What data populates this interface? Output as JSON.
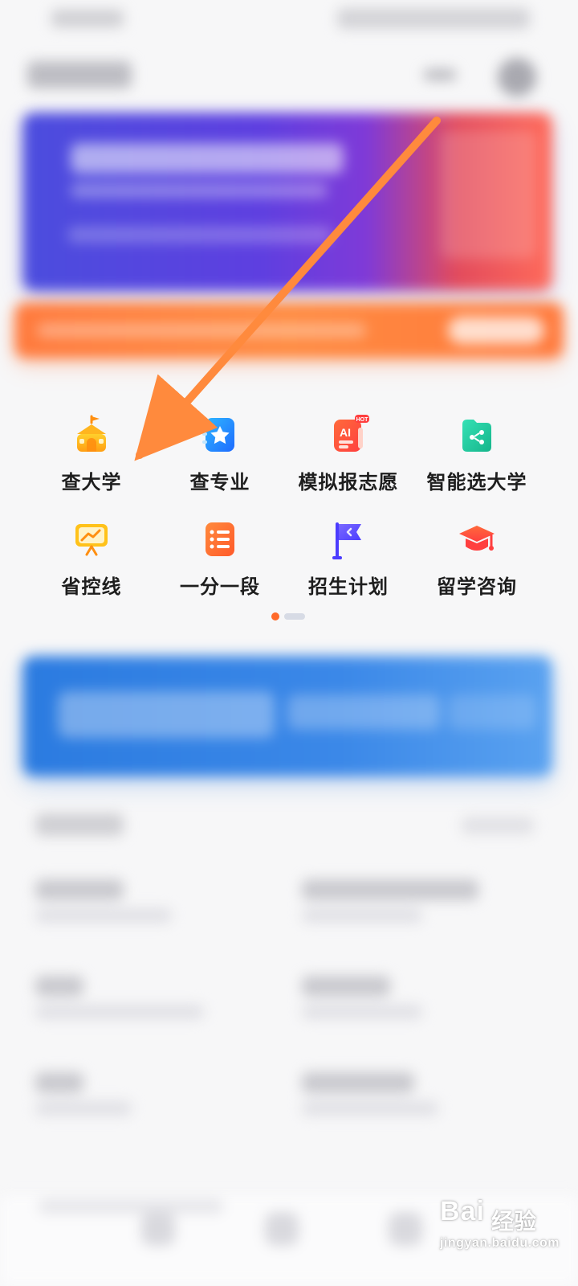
{
  "features": {
    "items": [
      {
        "label": "查大学",
        "icon": "school-building-icon"
      },
      {
        "label": "查专业",
        "icon": "major-book-icon"
      },
      {
        "label": "模拟报志愿",
        "icon": "ai-hot-icon"
      },
      {
        "label": "智能选大学",
        "icon": "share-folder-icon"
      },
      {
        "label": "省控线",
        "icon": "chart-board-icon"
      },
      {
        "label": "一分一段",
        "icon": "list-icon"
      },
      {
        "label": "招生计划",
        "icon": "flag-icon"
      },
      {
        "label": "留学咨询",
        "icon": "graduation-cap-icon"
      }
    ],
    "hot_badge": "HOT",
    "ai_label": "AI"
  },
  "pagination": {
    "active_index": 0,
    "count": 2
  },
  "watermark": {
    "brand": "Bai",
    "brand_cn": "经验",
    "url": "jingyan.baidu.com"
  },
  "colors": {
    "accent_orange": "#ff6a2a",
    "banner_blue": "#2b7be0",
    "banner_purple": "#4b4dde",
    "arrow_orange": "#ff8a3d"
  }
}
